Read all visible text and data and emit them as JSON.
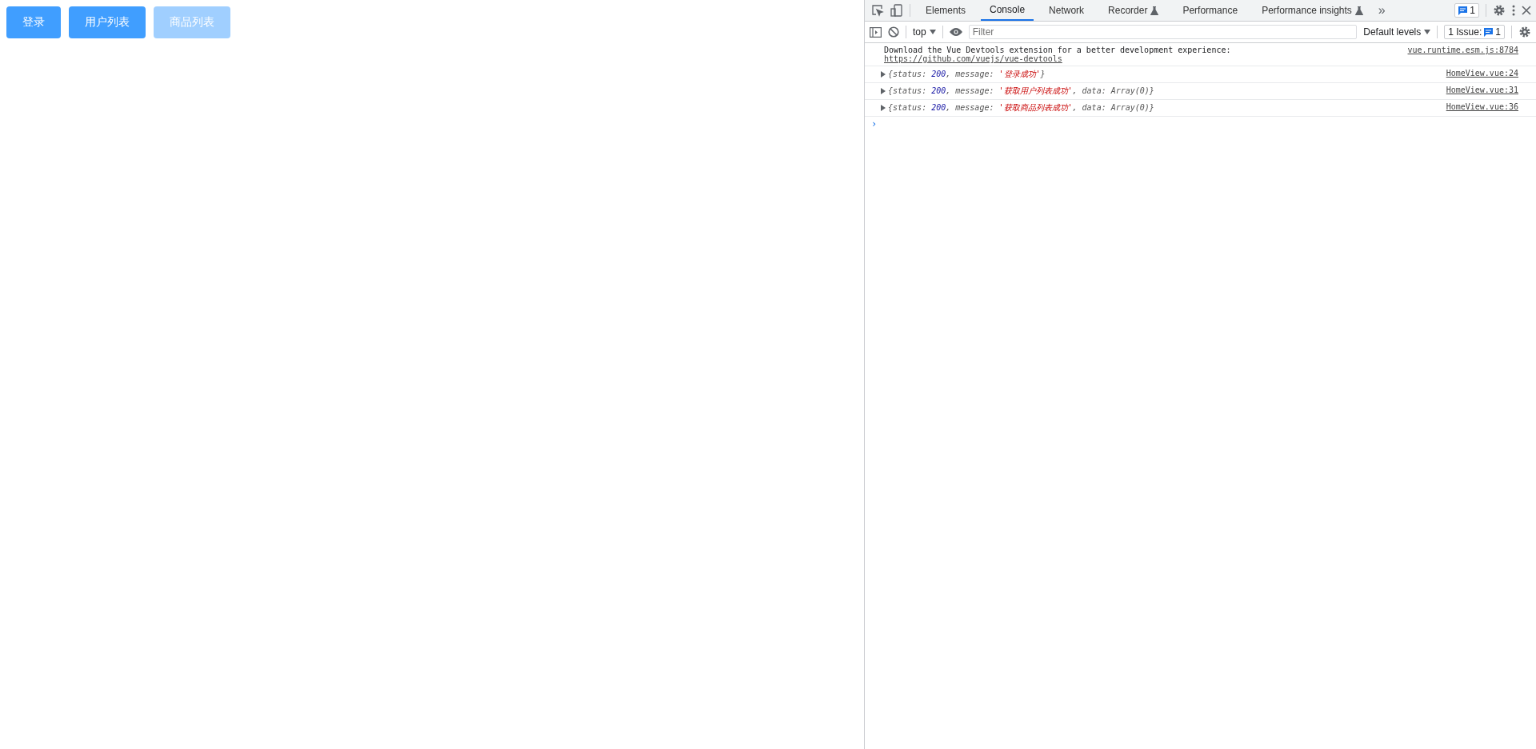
{
  "page": {
    "buttons": [
      {
        "label": "登录",
        "disabled": false
      },
      {
        "label": "用户列表",
        "disabled": false
      },
      {
        "label": "商品列表",
        "disabled": true
      }
    ]
  },
  "devtools": {
    "tabs": [
      {
        "label": "Elements",
        "selected": false,
        "experimental": false
      },
      {
        "label": "Console",
        "selected": true,
        "experimental": false
      },
      {
        "label": "Network",
        "selected": false,
        "experimental": false
      },
      {
        "label": "Recorder",
        "selected": false,
        "experimental": true
      },
      {
        "label": "Performance",
        "selected": false,
        "experimental": false
      },
      {
        "label": "Performance insights",
        "selected": false,
        "experimental": true
      }
    ],
    "more_tabs": "»",
    "issues_badge": "1",
    "console_toolbar": {
      "context": "top",
      "filter_placeholder": "Filter",
      "levels": "Default levels",
      "issues_label": "1 Issue:",
      "issues_count": "1"
    },
    "messages": [
      {
        "kind": "text",
        "lines": [
          "Download the Vue Devtools extension for a better development experience:"
        ],
        "link": "https://github.com/vuejs/vue-devtools",
        "source": "vue.runtime.esm.js:8784"
      },
      {
        "kind": "object",
        "parts": [
          {
            "kind": "plain",
            "text": "{status: "
          },
          {
            "kind": "number",
            "text": "200"
          },
          {
            "kind": "plain",
            "text": ", message: "
          },
          {
            "kind": "string",
            "text": "'登录成功'"
          },
          {
            "kind": "plain",
            "text": "}"
          }
        ],
        "source": "HomeView.vue:24"
      },
      {
        "kind": "object",
        "parts": [
          {
            "kind": "plain",
            "text": "{status: "
          },
          {
            "kind": "number",
            "text": "200"
          },
          {
            "kind": "plain",
            "text": ", message: "
          },
          {
            "kind": "string",
            "text": "'获取用户列表成功'"
          },
          {
            "kind": "plain",
            "text": ", data: Array(0)}"
          }
        ],
        "source": "HomeView.vue:31"
      },
      {
        "kind": "object",
        "parts": [
          {
            "kind": "plain",
            "text": "{status: "
          },
          {
            "kind": "number",
            "text": "200"
          },
          {
            "kind": "plain",
            "text": ", message: "
          },
          {
            "kind": "string",
            "text": "'获取商品列表成功'"
          },
          {
            "kind": "plain",
            "text": ", data: Array(0)}"
          }
        ],
        "source": "HomeView.vue:36"
      }
    ],
    "prompt": "›"
  }
}
